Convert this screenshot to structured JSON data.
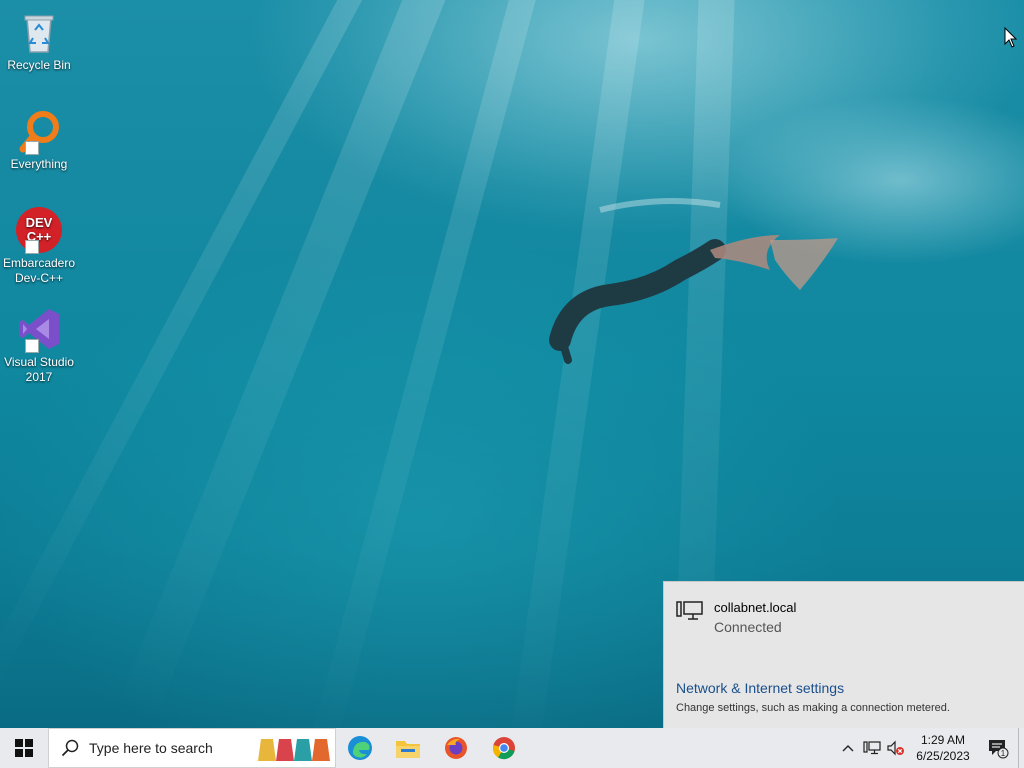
{
  "desktop": {
    "icons": [
      {
        "label_line1": "Recycle Bin",
        "label_line2": "",
        "icon": "recycle-bin-icon"
      },
      {
        "label_line1": "Everything",
        "label_line2": "",
        "icon": "everything-search-icon"
      },
      {
        "label_line1": "Embarcadero",
        "label_line2": "Dev-C++",
        "icon": "devcpp-icon",
        "glyph_text": "DEV C++"
      },
      {
        "label_line1": "Visual Studio",
        "label_line2": "2017",
        "icon": "visual-studio-icon"
      }
    ]
  },
  "network_flyout": {
    "network_name": "collabnet.local",
    "status": "Connected",
    "settings_link": "Network & Internet settings",
    "settings_desc": "Change settings, such as making a connection metered."
  },
  "taskbar": {
    "search_placeholder": "Type here to search",
    "pinned": [
      "edge-icon",
      "file-explorer-icon",
      "firefox-icon",
      "chrome-icon"
    ],
    "clock_time": "1:29 AM",
    "clock_date": "6/25/2023",
    "notification_count": "1"
  },
  "colors": {
    "taskbar_bg": "#e8eaed",
    "flyout_bg": "#e6e6e6",
    "link": "#1a4f8c"
  }
}
